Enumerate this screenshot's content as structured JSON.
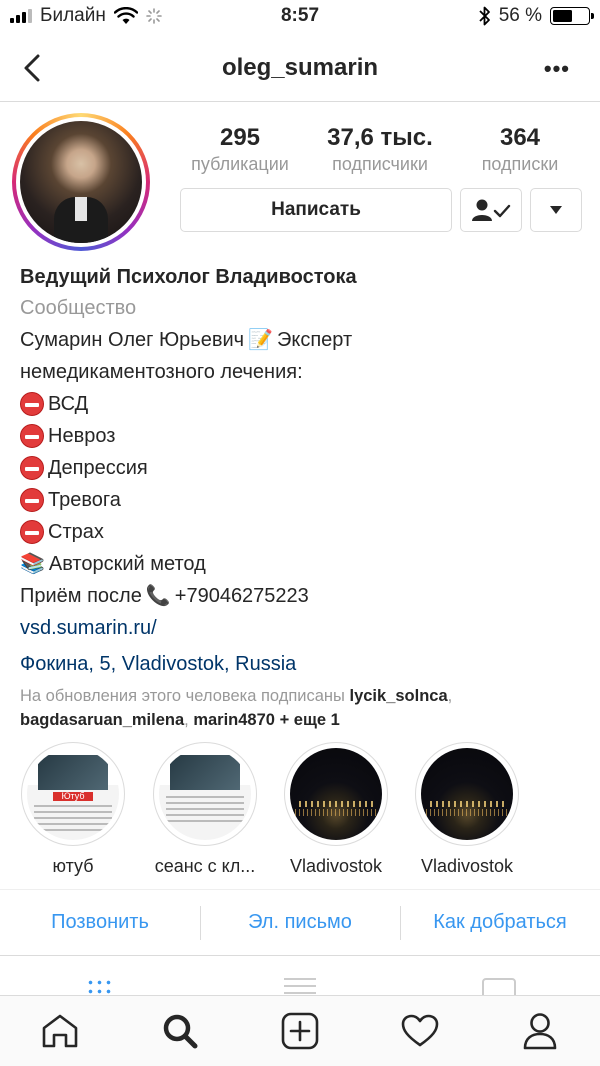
{
  "status_bar": {
    "carrier": "Билайн",
    "time": "8:57",
    "battery_percent": "56 %",
    "battery_level": 0.56
  },
  "nav": {
    "title": "oleg_sumarin",
    "back_icon": "chevron-left-icon",
    "more_icon": "more-dots-icon",
    "more_label": "•••"
  },
  "profile": {
    "stats": [
      {
        "value": "295",
        "label": "публикации"
      },
      {
        "value": "37,6 тыс.",
        "label": "подписчики"
      },
      {
        "value": "364",
        "label": "подписки"
      }
    ],
    "message_button": "Написать"
  },
  "bio": {
    "name": "Ведущий Психолог Владивостока",
    "category": "Сообщество",
    "line1": "Сумарин Олег Юрьевич",
    "line1_emoji": "📝",
    "line1_tail": "Эксперт",
    "line2": "немедикаментозного лечения:",
    "items": [
      "ВСД",
      "Невроз",
      "Депрессия",
      "Тревога",
      "Страх"
    ],
    "method_emoji": "📚",
    "method": "Авторский метод",
    "reception_prefix": "Приём после",
    "phone_emoji": "📞",
    "phone": "+79046275223",
    "link": "vsd.sumarin.ru/",
    "address": "Фокина, 5, Vladivostok, Russia",
    "followed_by_prefix": "На обновления этого человека подписаны",
    "followed_by_users": [
      "lycik_solnca",
      "bagdasaruan_milena",
      "marin4870"
    ],
    "followed_by_more": "+ еще 1"
  },
  "highlights": [
    {
      "label": "ютуб",
      "thumb_tag": "Ютуб"
    },
    {
      "label": "сеанс с кл..."
    },
    {
      "label": "Vladivostok"
    },
    {
      "label": "Vladivostok"
    }
  ],
  "contacts": [
    "Позвонить",
    "Эл. письмо",
    "Как добраться"
  ],
  "colors": {
    "accent_blue": "#3897f0",
    "link_dark_blue": "#003569",
    "muted_gray": "#999999"
  }
}
